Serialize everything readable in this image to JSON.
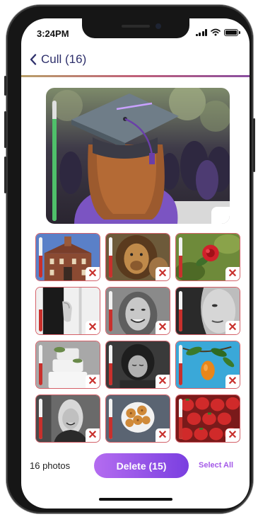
{
  "status_bar": {
    "time": "3:24PM"
  },
  "nav": {
    "back_icon": "chevron-left-icon",
    "title": "Cull (16)"
  },
  "colors": {
    "accent_purple": "#8a4fe6",
    "reject_red": "#c8302c",
    "keep_green": "#4fc06a",
    "title_navy": "#2d2f6b"
  },
  "hero": {
    "subject": "graduate wearing mortarboard cap",
    "quality_level": 0.85
  },
  "photos": [
    {
      "subject": "historic brick building",
      "quality_level": 0.55,
      "marked_for_delete": true
    },
    {
      "subject": "lion",
      "quality_level": 0.55,
      "marked_for_delete": true
    },
    {
      "subject": "red rose",
      "quality_level": 0.55,
      "marked_for_delete": true
    },
    {
      "subject": "hand on white door",
      "quality_level": 0.55,
      "marked_for_delete": true
    },
    {
      "subject": "smiling woman portrait",
      "quality_level": 0.55,
      "marked_for_delete": true
    },
    {
      "subject": "woman face close-up",
      "quality_level": 0.55,
      "marked_for_delete": true
    },
    {
      "subject": "wedding cake",
      "quality_level": 0.55,
      "marked_for_delete": true
    },
    {
      "subject": "woman looking down",
      "quality_level": 0.55,
      "marked_for_delete": true
    },
    {
      "subject": "orange fruit on branch",
      "quality_level": 0.55,
      "marked_for_delete": true
    },
    {
      "subject": "blonde woman portrait",
      "quality_level": 0.55,
      "marked_for_delete": true
    },
    {
      "subject": "bowl of cookies",
      "quality_level": 0.55,
      "marked_for_delete": true
    },
    {
      "subject": "strawberries",
      "quality_level": 0.55,
      "marked_for_delete": true
    }
  ],
  "footer": {
    "count_label": "16 photos",
    "delete_label": "Delete (15)",
    "select_all_label": "Select All"
  }
}
